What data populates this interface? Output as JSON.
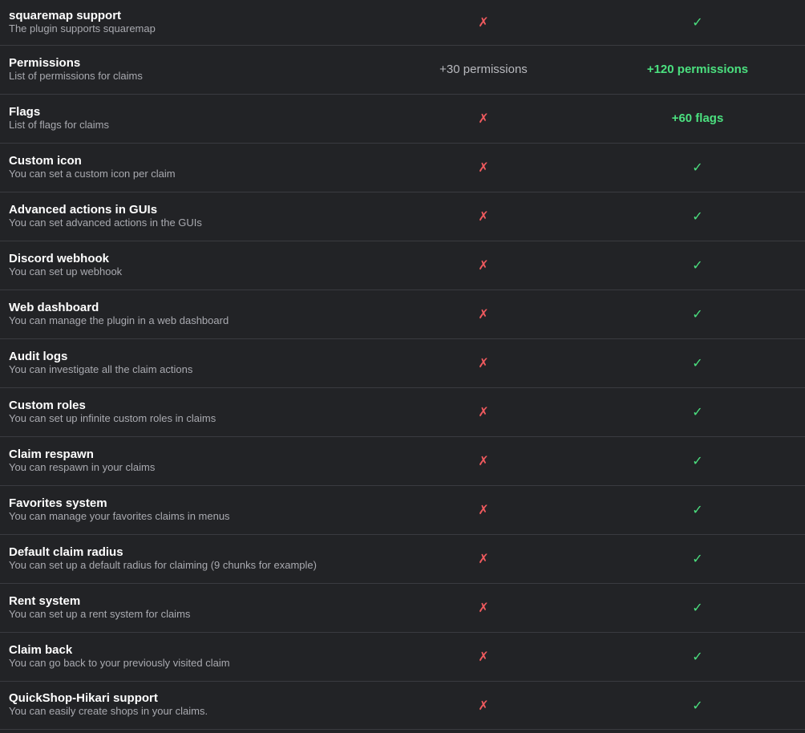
{
  "icons": {
    "cross": "cross-icon",
    "check": "check-icon",
    "cross_glyph": "✗",
    "check_glyph": "✓"
  },
  "colors": {
    "background": "#222326",
    "divider": "#3a3b40",
    "cross": "#f05a5e",
    "check": "#4be07f"
  },
  "rows": [
    {
      "title": "squaremap support",
      "desc": "The plugin supports squaremap",
      "free": "cross",
      "premium": "check"
    },
    {
      "title": "Permissions",
      "desc": "List of permissions for claims",
      "free_text": "+30 permissions",
      "premium_text": "+120 permissions"
    },
    {
      "title": "Flags",
      "desc": "List of flags for claims",
      "free": "cross",
      "premium_text": "+60 flags"
    },
    {
      "title": "Custom icon",
      "desc": "You can set a custom icon per claim",
      "free": "cross",
      "premium": "check"
    },
    {
      "title": "Advanced actions in GUIs",
      "desc": "You can set advanced actions in the GUIs",
      "free": "cross",
      "premium": "check"
    },
    {
      "title": "Discord webhook",
      "desc": "You can set up webhook",
      "free": "cross",
      "premium": "check"
    },
    {
      "title": "Web dashboard",
      "desc": "You can manage the plugin in a web dashboard",
      "free": "cross",
      "premium": "check"
    },
    {
      "title": "Audit logs",
      "desc": "You can investigate all the claim actions",
      "free": "cross",
      "premium": "check"
    },
    {
      "title": "Custom roles",
      "desc": "You can set up infinite custom roles in claims",
      "free": "cross",
      "premium": "check"
    },
    {
      "title": "Claim respawn",
      "desc": "You can respawn in your claims",
      "free": "cross",
      "premium": "check"
    },
    {
      "title": "Favorites system",
      "desc": "You can manage your favorites claims in menus",
      "free": "cross",
      "premium": "check"
    },
    {
      "title": "Default claim radius",
      "desc": "You can set up a default radius for claiming (9 chunks for example)",
      "free": "cross",
      "premium": "check"
    },
    {
      "title": "Rent system",
      "desc": "You can set up a rent system for claims",
      "free": "cross",
      "premium": "check"
    },
    {
      "title": "Claim back",
      "desc": "You can go back to your previously visited claim",
      "free": "cross",
      "premium": "check"
    },
    {
      "title": "QuickShop-Hikari support",
      "desc": "You can easily create shops in your claims.",
      "free": "cross",
      "premium": "check"
    }
  ]
}
